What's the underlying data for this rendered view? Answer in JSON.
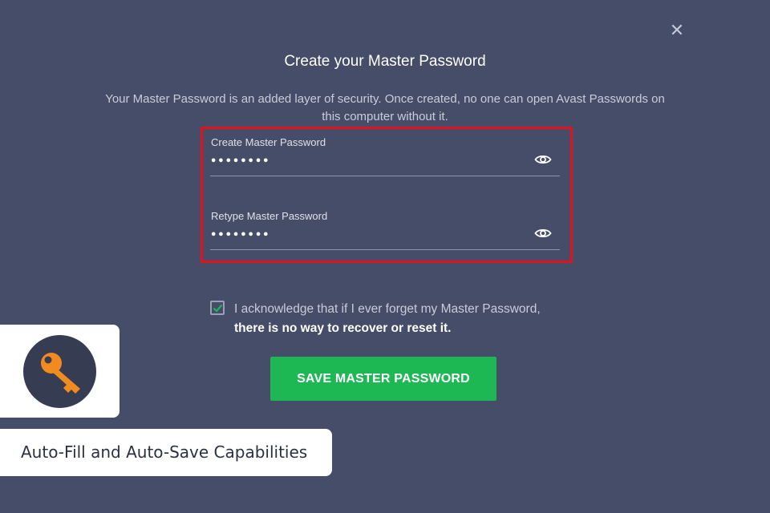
{
  "dialog": {
    "close_glyph": "✕",
    "title": "Create your Master Password",
    "description": "Your Master Password is an added layer of security. Once created, no one can open Avast Passwords on this computer without it."
  },
  "fields": [
    {
      "label": "Create Master Password",
      "value": "••••••••",
      "icon": "eye-icon"
    },
    {
      "label": "Retype Master Password",
      "value": "••••••••",
      "icon": "eye-icon"
    }
  ],
  "acknowledge": {
    "checked": true,
    "text_plain": "I acknowledge that if I ever forget my Master Password, ",
    "text_bold": "there is no way to recover or reset it."
  },
  "save_button": {
    "label": "SAVE MASTER PASSWORD"
  },
  "overlay": {
    "feature_label": "Auto-Fill and Auto-Save Capabilities",
    "logo_icon": "key-icon"
  },
  "colors": {
    "background": "#454d68",
    "highlight": "#e0121b",
    "accent_green": "#1db754",
    "key_orange": "#f28b1f"
  }
}
